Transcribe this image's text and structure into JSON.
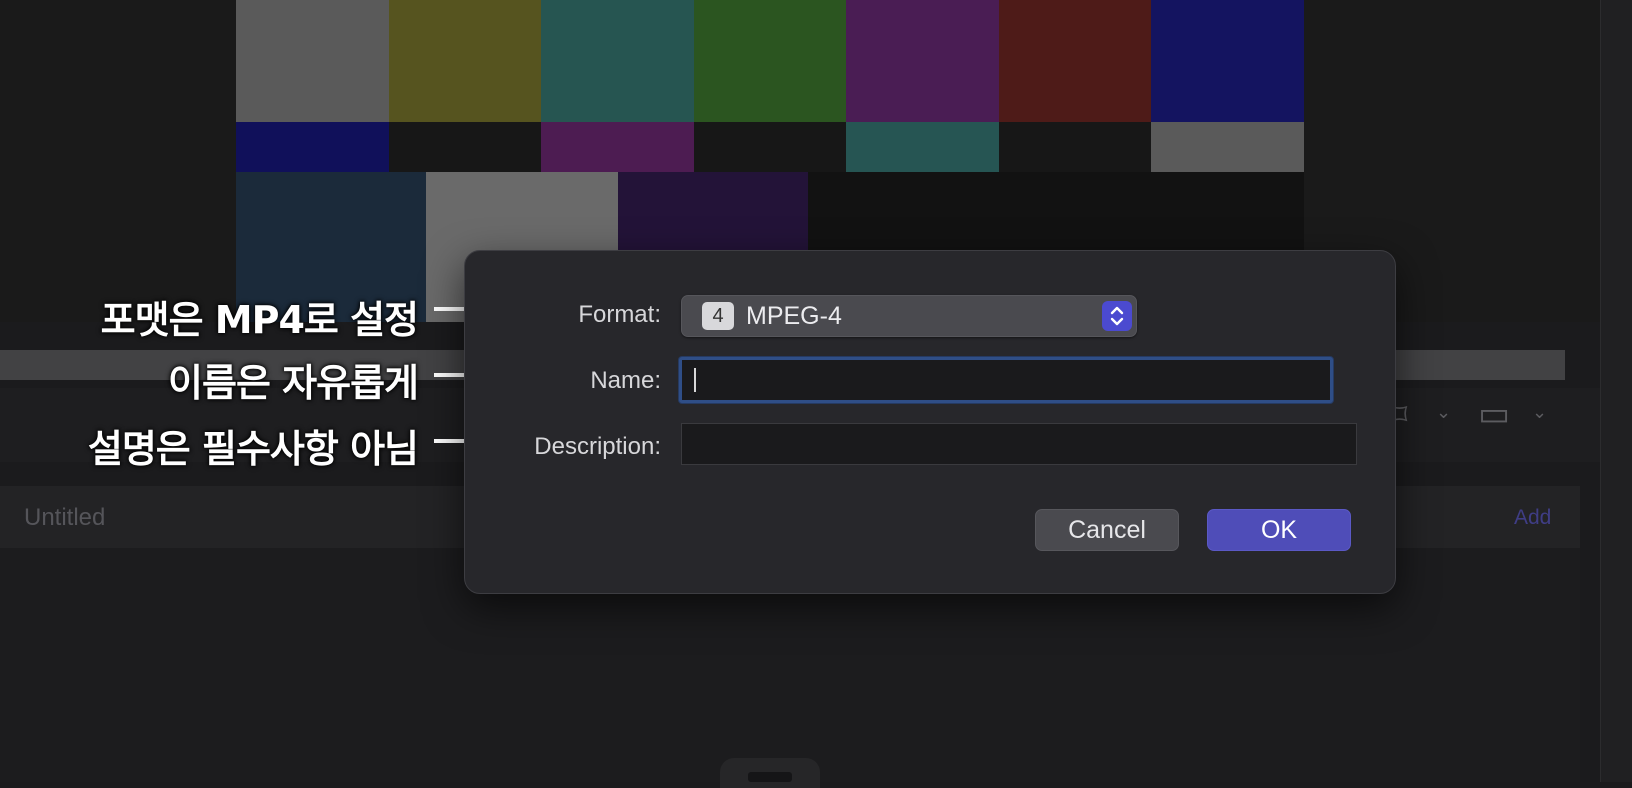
{
  "background": {
    "document_title": "Untitled",
    "add_label": "Add",
    "color_bars_top": [
      "#5a5a5a",
      "#56541f",
      "#265551",
      "#2b5520",
      "#4a1d54",
      "#4e1b18",
      "#141460"
    ],
    "color_bars_mid": [
      "#10105a",
      "#171717",
      "#4d1c52",
      "#171717",
      "#265553",
      "#171717",
      "#5a5a5a"
    ],
    "color_bars_bottom": [
      "#1b2a3a",
      "#6a6a6a",
      "#231338",
      "#121212",
      "#121212",
      "#121212"
    ]
  },
  "annotations": [
    {
      "text": "포맷은 MP4로 설정"
    },
    {
      "text": "이름은 자유롭게"
    },
    {
      "text": "설명은 필수사항 아님"
    }
  ],
  "dialog": {
    "format_label": "Format:",
    "format_badge": "4",
    "format_value": "MPEG-4",
    "name_label": "Name:",
    "name_value": "",
    "description_label": "Description:",
    "description_value": "",
    "cancel_label": "Cancel",
    "ok_label": "OK",
    "accent_color": "#4f4db8"
  }
}
